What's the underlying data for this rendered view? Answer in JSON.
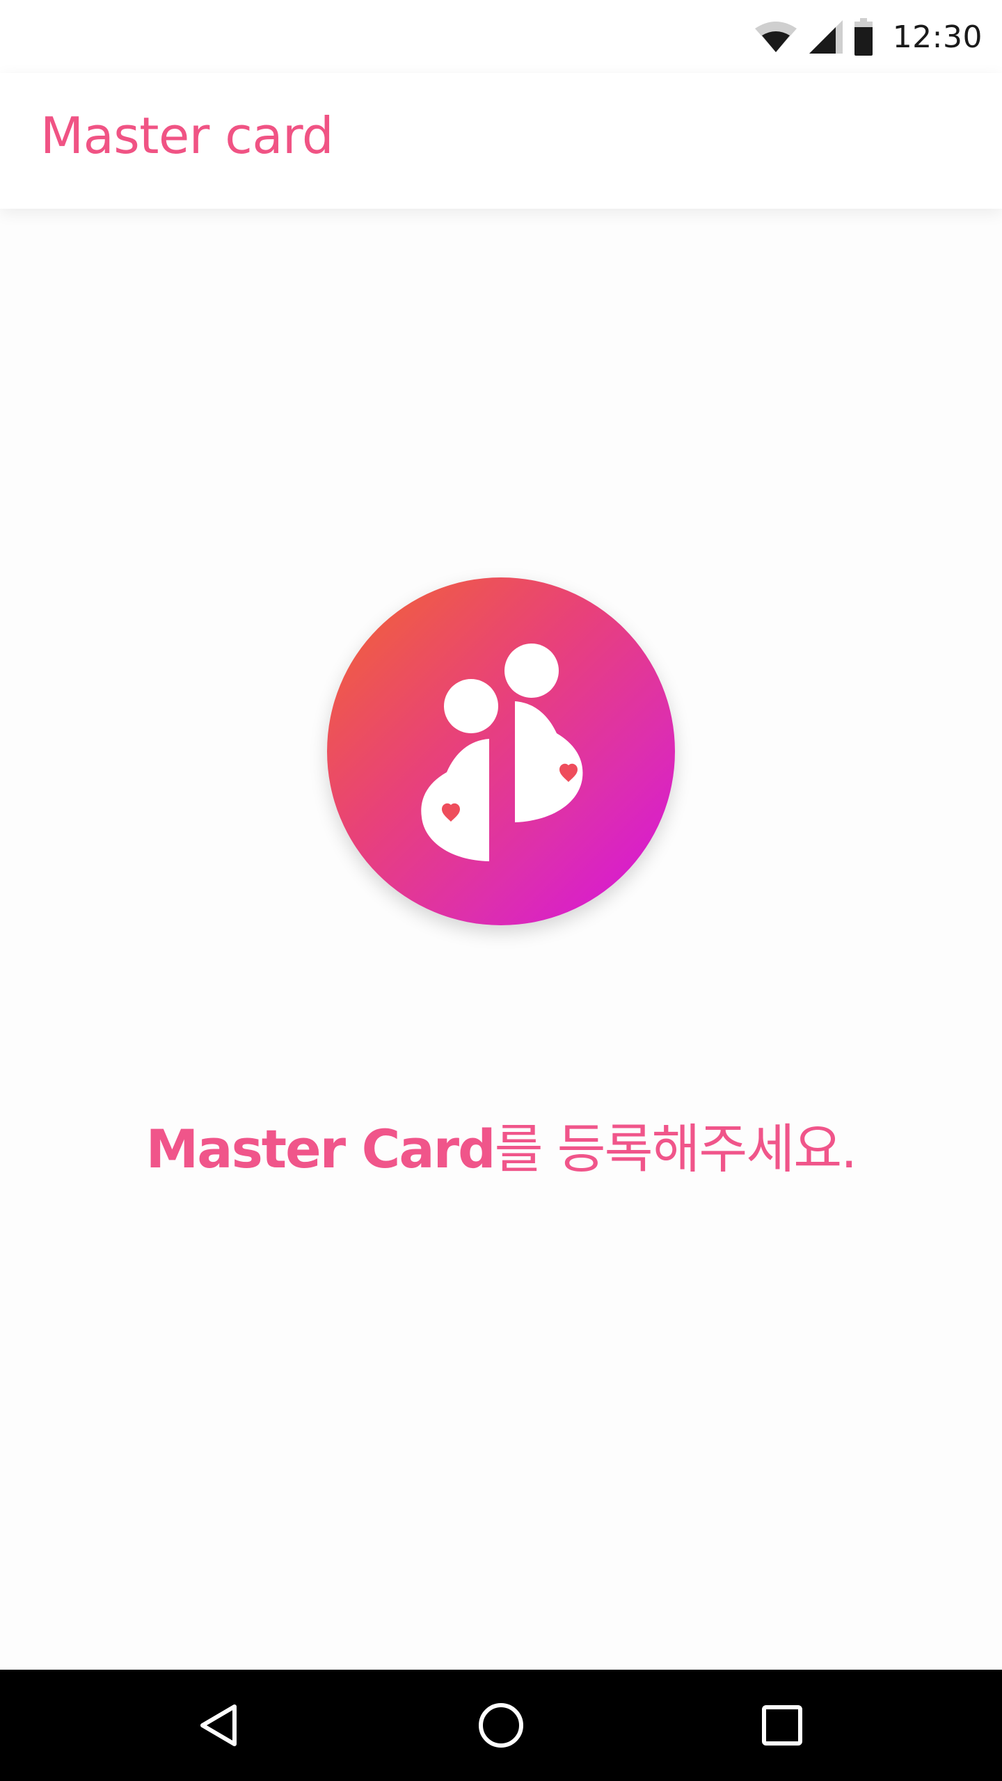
{
  "status_bar": {
    "time": "12:30",
    "icons": [
      "wifi-icon",
      "cellular-signal-icon",
      "battery-icon"
    ]
  },
  "app_bar": {
    "title": "Master card"
  },
  "main": {
    "logo_icon": "couple-hearts-logo-icon",
    "message_strong": "Master Card",
    "message_rest": "를 등록해주세요."
  },
  "nav_bar": {
    "icons": [
      "back-triangle-icon",
      "home-circle-icon",
      "recents-square-icon"
    ]
  },
  "colors": {
    "accent": "#f05384",
    "gradient_start": "#f26631",
    "gradient_end": "#d512e0",
    "heart": "#ee4d5c",
    "nav_background": "#000000"
  }
}
